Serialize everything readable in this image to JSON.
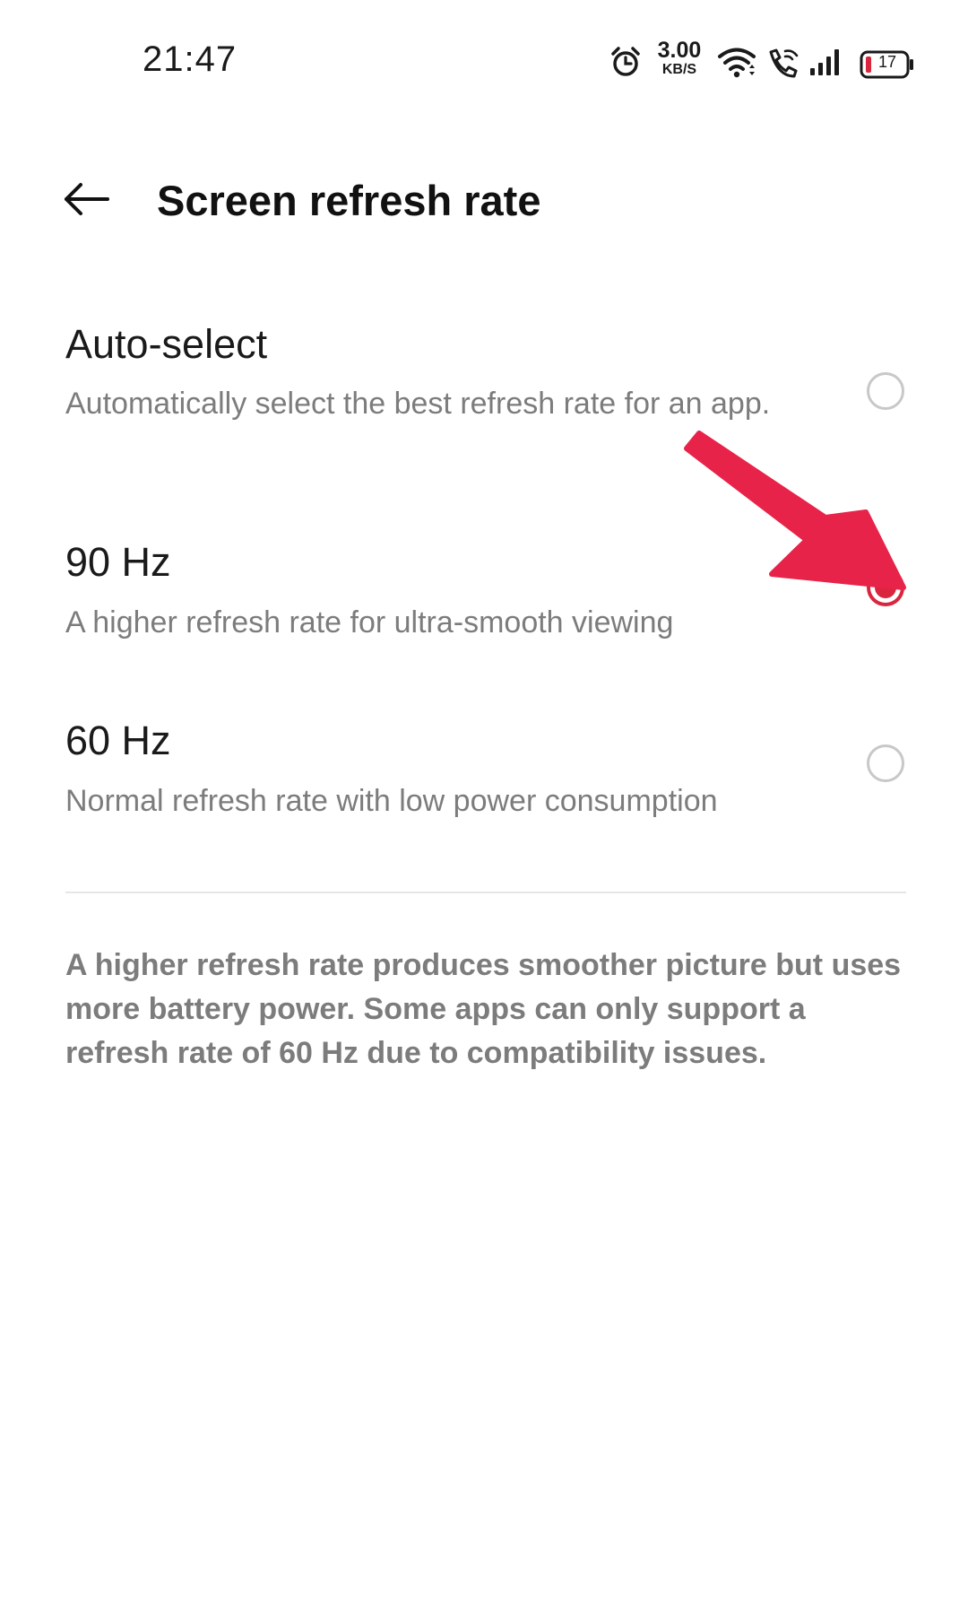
{
  "status_bar": {
    "time": "21:47",
    "net_speed_value": "3.00",
    "net_speed_unit": "KB/S",
    "battery_level": "17",
    "icons": [
      "alarm-icon",
      "wifi-icon",
      "wifi-call-icon",
      "signal-icon",
      "battery-icon"
    ]
  },
  "header": {
    "back_icon": "arrow-left-icon",
    "title": "Screen refresh rate"
  },
  "options": [
    {
      "title": "Auto-select",
      "description": "Automatically select the best refresh rate for an app.",
      "selected": false
    },
    {
      "title": "90 Hz",
      "description": "A higher refresh rate for ultra-smooth viewing",
      "selected": true
    },
    {
      "title": "60 Hz",
      "description": "Normal refresh rate with low power consumption",
      "selected": false
    }
  ],
  "footnote": "A higher refresh rate produces smoother picture but uses more battery power. Some apps can only support a refresh rate of 60 Hz due to compatibility issues.",
  "colors": {
    "accent": "#d9263e",
    "annotation_arrow": "#e8234a",
    "secondary_text": "#7c7c7c",
    "radio_unchecked": "#c8c8c8"
  }
}
